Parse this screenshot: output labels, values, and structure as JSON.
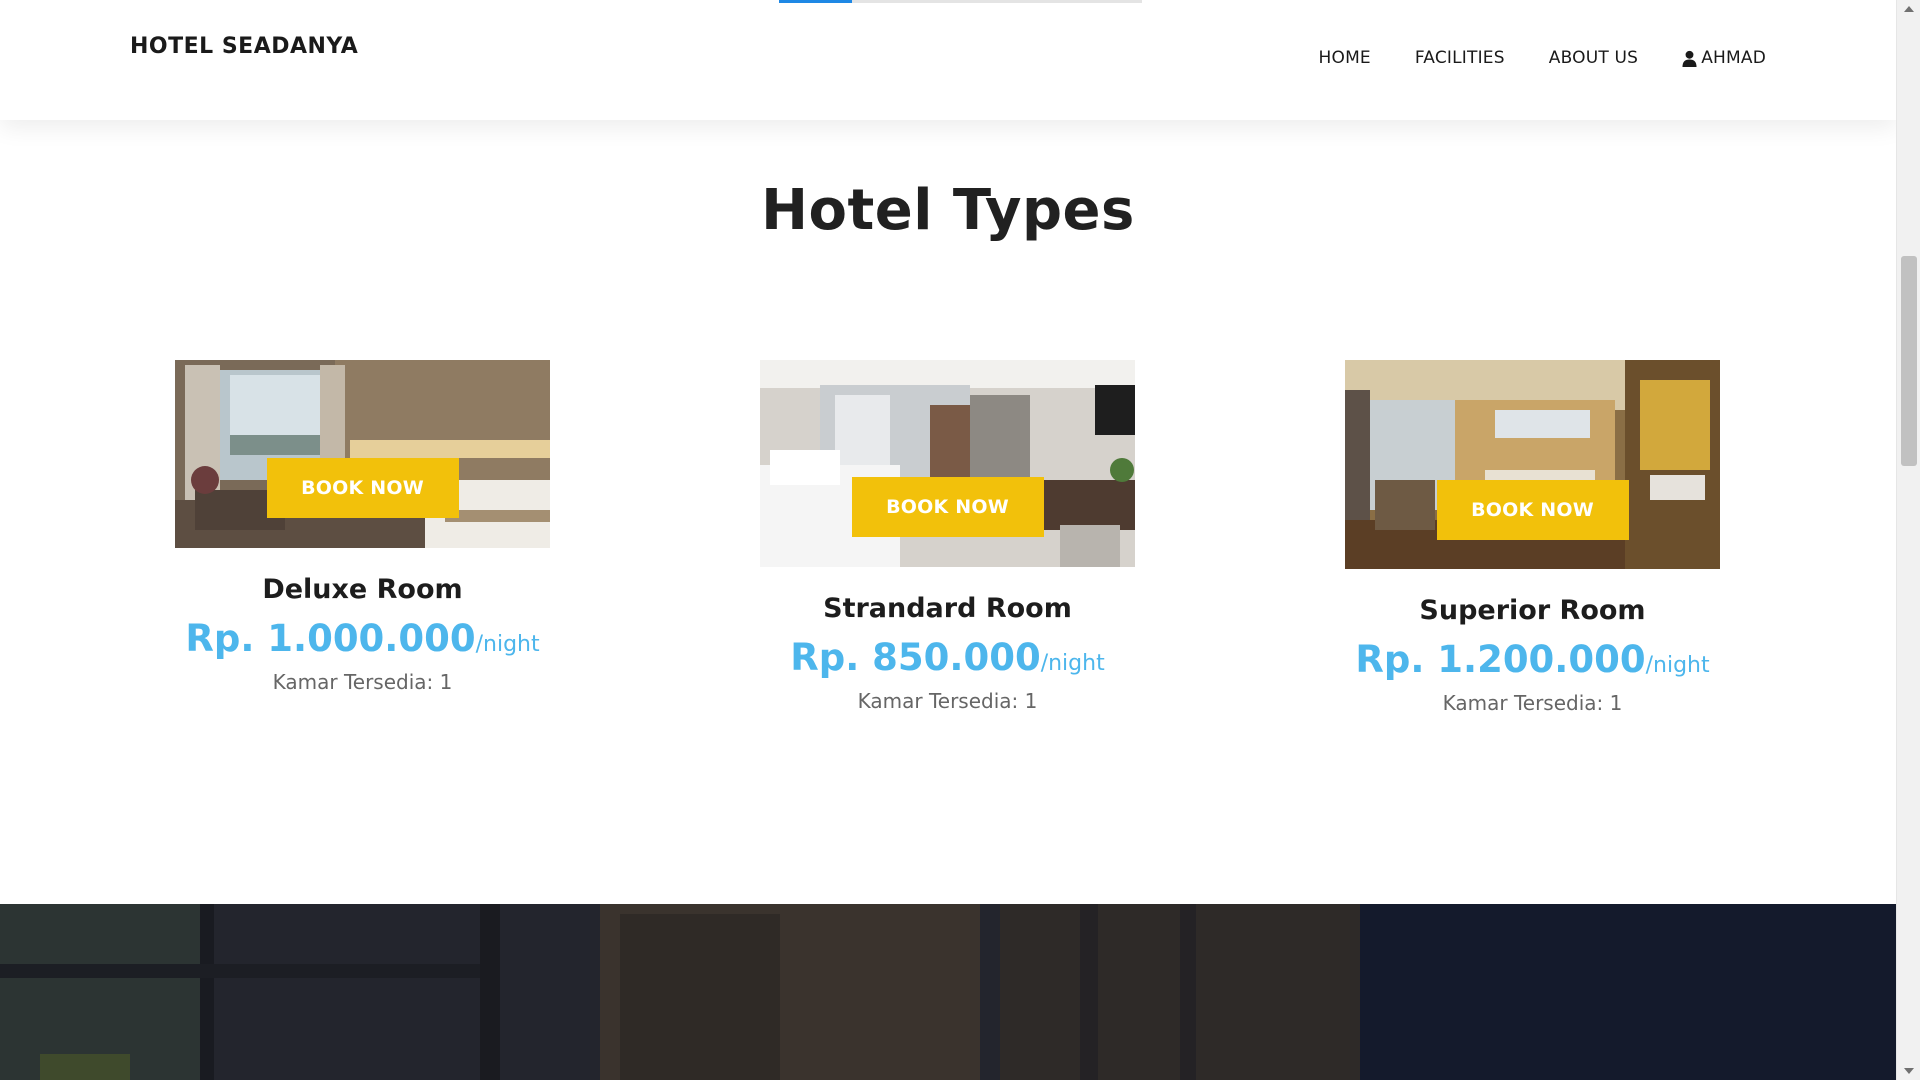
{
  "header": {
    "brand": "HOTEL SEADANYA",
    "scroll_progress_percent": 20,
    "nav": {
      "home": "HOME",
      "facilities": "FACILITIES",
      "about": "ABOUT US",
      "user": "AHMAD",
      "user_icon": "user-icon"
    }
  },
  "section": {
    "title": "Hotel Types",
    "rooms": [
      {
        "name": "Deluxe Room",
        "price": "Rp. 1.000.000",
        "unit": "/night",
        "availability": "Kamar Tersedia: 1",
        "button": "BOOK NOW"
      },
      {
        "name": "Strandard Room",
        "price": "Rp. 850.000",
        "unit": "/night",
        "availability": "Kamar Tersedia: 1",
        "button": "BOOK NOW"
      },
      {
        "name": "Superior Room",
        "price": "Rp. 1.200.000",
        "unit": "/night",
        "availability": "Kamar Tersedia: 1",
        "button": "BOOK NOW"
      }
    ]
  },
  "colors": {
    "accent_yellow": "#f2c10b",
    "price_blue": "#4db6ec",
    "progress_blue": "#1e88e5",
    "dark_band": "#151a2c"
  }
}
